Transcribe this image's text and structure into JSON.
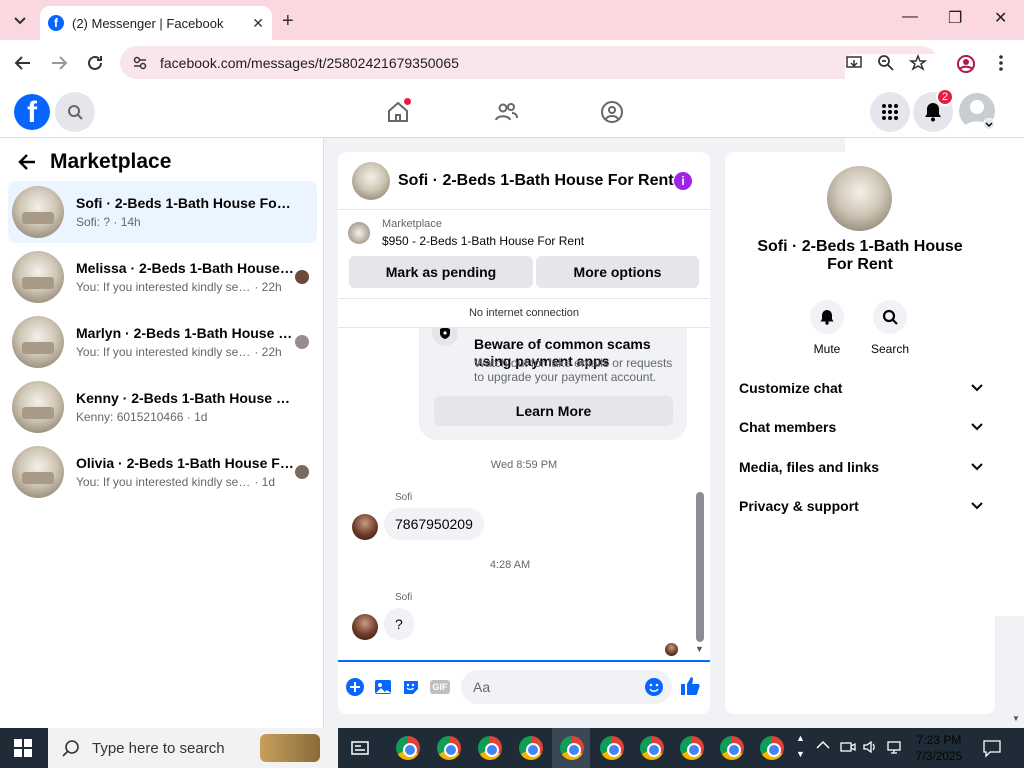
{
  "browser": {
    "tab_title": "(2) Messenger | Facebook",
    "url": "facebook.com/messages/t/25802421679350065"
  },
  "fb": {
    "notif_count": "2"
  },
  "left": {
    "header": "Marketplace",
    "conversations": [
      {
        "title": "Sofi · 2-Beds 1-Bath House For Rent",
        "preview": "Sofi: ?",
        "time": "14h"
      },
      {
        "title": "Melissa · 2-Beds 1-Bath House F...",
        "preview": "You: If you interested kindly send ...",
        "time": "22h"
      },
      {
        "title": "Marlyn · 2-Beds 1-Bath House F...",
        "preview": "You: If you interested kindly send ...",
        "time": "22h"
      },
      {
        "title": "Kenny · 2-Beds 1-Bath House For R...",
        "preview": "Kenny: 6015210466",
        "time": "1d"
      },
      {
        "title": "Olivia · 2-Beds 1-Bath House For...",
        "preview": "You: If you interested kindly send ...",
        "time": "1d"
      }
    ]
  },
  "chat": {
    "title": "Sofi · 2-Beds 1-Bath House For Rent",
    "marketplace_label": "Marketplace",
    "listing": "$950 - 2-Beds 1-Bath House For Rent",
    "mark_pending": "Mark as pending",
    "more_options": "More options",
    "no_internet": "No internet connection",
    "warning_title": "Beware of common scams using payment apps",
    "warning_text": "Watch out for fake emails or requests to upgrade your payment account.",
    "learn_more": "Learn More",
    "ts1": "Wed 8:59 PM",
    "sender": "Sofi",
    "msg1": "7867950209",
    "ts2": "4:28 AM",
    "msg2": "?",
    "placeholder": "Aa"
  },
  "right": {
    "title": "Sofi · 2-Beds 1-Bath House For Rent",
    "mute": "Mute",
    "search": "Search",
    "sections": [
      "Customize chat",
      "Chat members",
      "Media, files and links",
      "Privacy & support"
    ]
  },
  "taskbar": {
    "search_placeholder": "Type here to search",
    "time": "7:23 PM",
    "date": "7/3/2025"
  }
}
